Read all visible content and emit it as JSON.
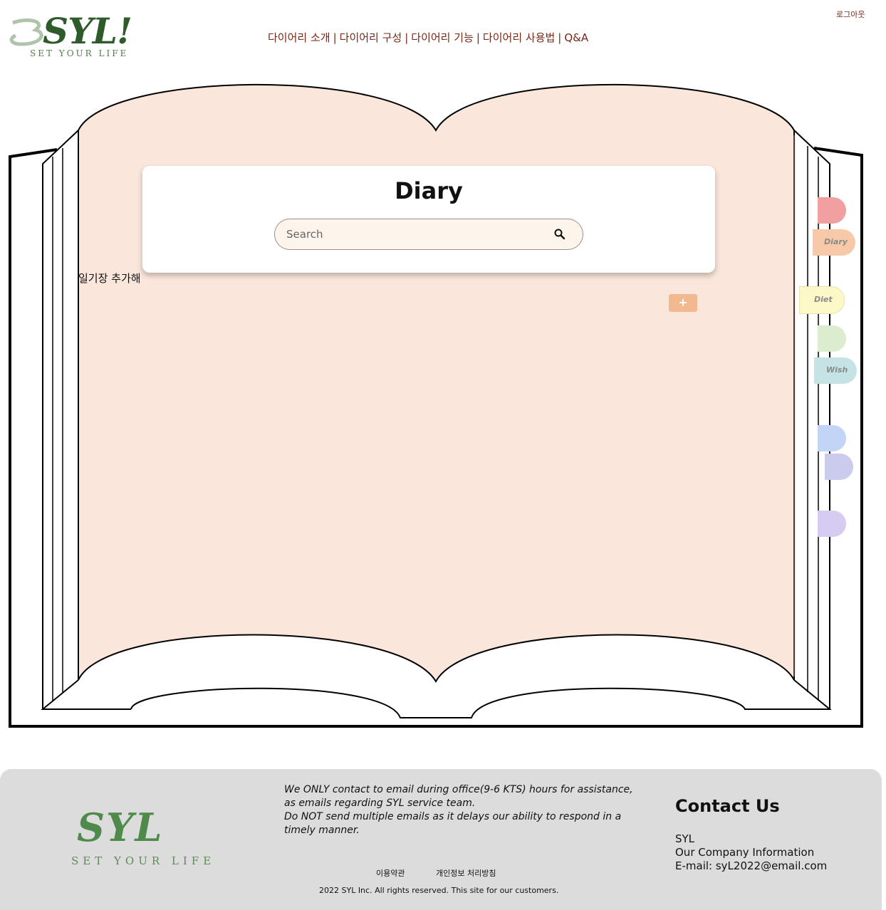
{
  "header": {
    "logo_text": "SYL!",
    "logo_prefix": "3",
    "logo_tagline": "SET YOUR LIFE",
    "logout_label": "로그아웃",
    "nav": [
      {
        "label": "다이어리 소개"
      },
      {
        "label": "다이어리 구성"
      },
      {
        "label": "다이어리 기능"
      },
      {
        "label": "다이어리 사용법"
      },
      {
        "label": "Q&A"
      }
    ],
    "nav_separator": "|"
  },
  "diary": {
    "title": "Diary",
    "search_placeholder": "Search",
    "add_label": "일기장 추가해",
    "add_button_label": "+"
  },
  "tabs": [
    {
      "label": "",
      "color": "#f0a0a0",
      "icon": "tab-1"
    },
    {
      "label": "Diary",
      "color": "#f7c9a8",
      "icon": "tab-diary"
    },
    {
      "label": "Diet",
      "color": "#fdf8c8",
      "icon": "tab-diet"
    },
    {
      "label": "",
      "color": "#dcedcf",
      "icon": "tab-4"
    },
    {
      "label": "Wish",
      "color": "#c5e3e5",
      "icon": "tab-wish"
    },
    {
      "label": "",
      "color": "#c3d5f7",
      "icon": "tab-6"
    },
    {
      "label": "",
      "color": "#cacbed",
      "icon": "tab-7"
    },
    {
      "label": "",
      "color": "#d6cbf0",
      "icon": "tab-8"
    }
  ],
  "colors": {
    "page": "#fae6da",
    "nav_text": "#7a2618",
    "add_button": "#f2b890",
    "footer_bg": "#dcdcdc"
  },
  "footer": {
    "logo_text": "SYL",
    "logo_tagline": "SET YOUR LIFE",
    "notice_1": "We ONLY contact to email during office(9-6 KTS) hours for assistance, as emails regarding SYL service team.",
    "notice_2": "Do NOT send multiple emails as it delays our ability to respond in a timely manner.",
    "terms_label": "이용약관",
    "privacy_label": "개인정보 처리방침",
    "copyright": "2022 SYL Inc. All rights reserved. This site for our customers.",
    "contact_title": "Contact Us",
    "contact_company": "SYL",
    "contact_info": "Our Company Information",
    "contact_email": "E-mail: syL2022@email.com"
  }
}
